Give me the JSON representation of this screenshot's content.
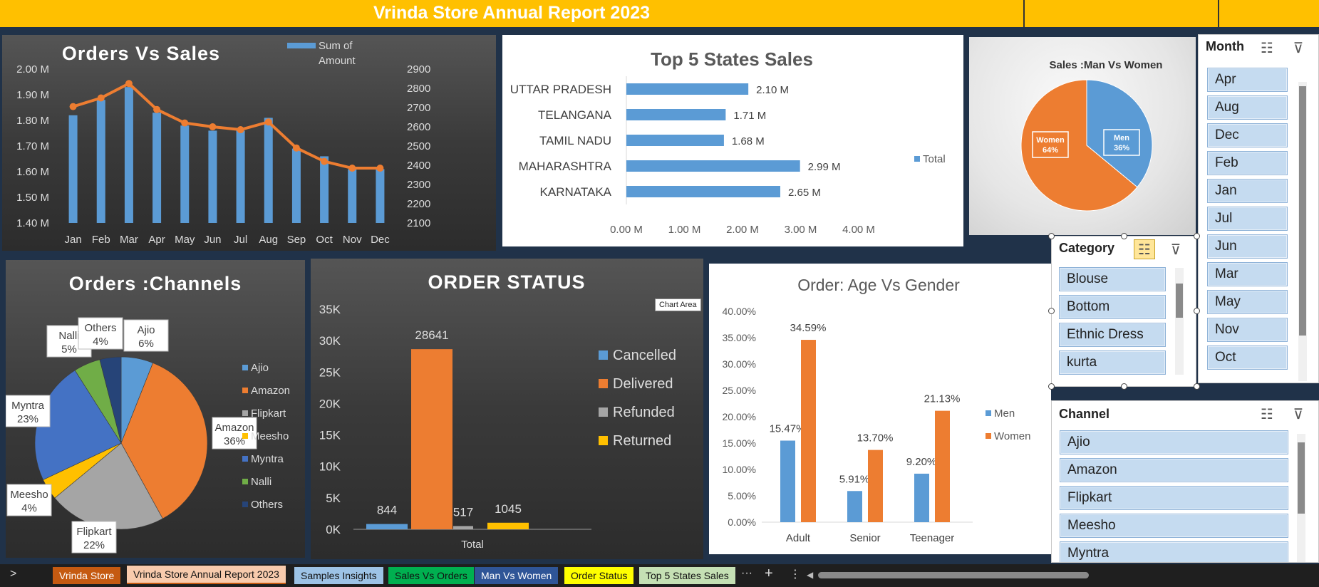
{
  "report_title": "Vrinda Store Annual Report 2023",
  "chart_area_tooltip": "Chart Area",
  "charts": {
    "orders_sales": {
      "title": "Orders Vs Sales",
      "legend_label_1": "Sum of",
      "legend_label_2": "Amount",
      "categories": [
        "Jan",
        "Feb",
        "Mar",
        "Apr",
        "May",
        "Jun",
        "Jul",
        "Aug",
        "Sep",
        "Oct",
        "Nov",
        "Dec"
      ],
      "left_ticks": [
        "2.00 M",
        "1.90 M",
        "1.80 M",
        "1.70 M",
        "1.60 M",
        "1.50 M",
        "1.40 M"
      ],
      "right_ticks": [
        "2900",
        "2800",
        "2700",
        "2600",
        "2500",
        "2400",
        "2300",
        "2200",
        "2100"
      ],
      "amount_values": [
        1.82,
        1.88,
        1.93,
        1.83,
        1.78,
        1.76,
        1.76,
        1.81,
        1.69,
        1.66,
        1.61,
        1.61
      ],
      "orders_values": [
        2705,
        2750,
        2825,
        2690,
        2620,
        2600,
        2585,
        2625,
        2490,
        2420,
        2385,
        2385
      ],
      "left_range": [
        1.4,
        2.0
      ],
      "right_range": [
        2100,
        2900
      ],
      "bar_color": "#5B9BD5",
      "line_color": "#ED7D31"
    },
    "top_states": {
      "title": "Top 5 States Sales",
      "states": [
        "UTTAR PRADESH",
        "TELANGANA",
        "TAMIL NADU",
        "MAHARASHTRA",
        "KARNATAKA"
      ],
      "values": [
        2.1,
        1.71,
        1.68,
        2.99,
        2.65
      ],
      "value_labels": [
        "2.10 M",
        "1.71 M",
        "1.68 M",
        "2.99 M",
        "2.65 M"
      ],
      "x_ticks": [
        "0.00 M",
        "1.00 M",
        "2.00 M",
        "3.00 M",
        "4.00 M"
      ],
      "x_range": [
        0,
        4
      ],
      "legend": "Total",
      "bar_color": "#5B9BD5"
    },
    "man_women": {
      "title": "Sales :Man Vs Women",
      "slices": [
        {
          "label": "Men",
          "pct_label": "36%",
          "value": 36,
          "color": "#5B9BD5"
        },
        {
          "label": "Women",
          "pct_label": "64%",
          "value": 64,
          "color": "#ED7D31"
        }
      ]
    },
    "channels": {
      "title": "Orders :Channels",
      "slices": [
        {
          "label": "Ajio",
          "pct_label": "6%",
          "value": 6,
          "color": "#5B9BD5"
        },
        {
          "label": "Amazon",
          "pct_label": "36%",
          "value": 36,
          "color": "#ED7D31"
        },
        {
          "label": "Flipkart",
          "pct_label": "22%",
          "value": 22,
          "color": "#A5A5A5"
        },
        {
          "label": "Meesho",
          "pct_label": "4%",
          "value": 4,
          "color": "#FFC000"
        },
        {
          "label": "Myntra",
          "pct_label": "23%",
          "value": 23,
          "color": "#4472C4"
        },
        {
          "label": "Nalli",
          "pct_label": "5%",
          "value": 5,
          "color": "#70AD47"
        },
        {
          "label": "Others",
          "pct_label": "4%",
          "value": 4,
          "color": "#264478"
        }
      ]
    },
    "order_status": {
      "title": "ORDER STATUS",
      "xlabel": "Total",
      "y_ticks": [
        "35K",
        "30K",
        "25K",
        "20K",
        "15K",
        "10K",
        "5K",
        "0K"
      ],
      "y_range": [
        0,
        35000
      ],
      "series": [
        {
          "name": "Cancelled",
          "value": 844,
          "label": "844",
          "color": "#5B9BD5"
        },
        {
          "name": "Delivered",
          "value": 28641,
          "label": "28641",
          "color": "#ED7D31"
        },
        {
          "name": "Refunded",
          "value": 517,
          "label": "517",
          "color": "#A5A5A5"
        },
        {
          "name": "Returned",
          "value": 1045,
          "label": "1045",
          "color": "#FFC000"
        }
      ]
    },
    "age_gender": {
      "title": "Order: Age Vs Gender",
      "categories": [
        "Adult",
        "Senior",
        "Teenager"
      ],
      "y_ticks": [
        "40.00%",
        "35.00%",
        "30.00%",
        "25.00%",
        "20.00%",
        "15.00%",
        "10.00%",
        "5.00%",
        "0.00%"
      ],
      "y_range": [
        0,
        40
      ],
      "series": [
        {
          "name": "Men",
          "values": [
            15.47,
            5.91,
            9.2
          ],
          "labels": [
            "15.47%",
            "5.91%",
            "9.20%"
          ],
          "color": "#5B9BD5"
        },
        {
          "name": "Women",
          "values": [
            34.59,
            13.7,
            21.13
          ],
          "labels": [
            "34.59%",
            "13.70%",
            "21.13%"
          ],
          "color": "#ED7D31"
        }
      ]
    }
  },
  "chart_data": [
    {
      "type": "bar",
      "title": "Orders Vs Sales",
      "categories": [
        "Jan",
        "Feb",
        "Mar",
        "Apr",
        "May",
        "Jun",
        "Jul",
        "Aug",
        "Sep",
        "Oct",
        "Nov",
        "Dec"
      ],
      "series": [
        {
          "name": "Sum of Amount",
          "values": [
            1.82,
            1.88,
            1.93,
            1.83,
            1.78,
            1.76,
            1.76,
            1.81,
            1.69,
            1.66,
            1.61,
            1.61
          ]
        },
        {
          "values": [
            2705,
            2750,
            2825,
            2690,
            2620,
            2600,
            2585,
            2625,
            2490,
            2420,
            2385,
            2385
          ]
        }
      ],
      "ylim": [
        1.4,
        2.0
      ],
      "y2lim": [
        2100,
        2900
      ]
    },
    {
      "type": "bar",
      "title": "Top 5 States Sales",
      "categories": [
        "UTTAR PRADESH",
        "TELANGANA",
        "TAMIL NADU",
        "MAHARASHTRA",
        "KARNATAKA"
      ],
      "series": [
        {
          "name": "Total",
          "values": [
            2.1,
            1.71,
            1.68,
            2.99,
            2.65
          ]
        }
      ],
      "xlim": [
        0,
        4
      ]
    },
    {
      "type": "pie",
      "title": "Sales :Man Vs Women",
      "categories": [
        "Men",
        "Women"
      ],
      "values": [
        36,
        64
      ]
    },
    {
      "type": "pie",
      "title": "Orders :Channels",
      "categories": [
        "Ajio",
        "Amazon",
        "Flipkart",
        "Meesho",
        "Myntra",
        "Nalli",
        "Others"
      ],
      "values": [
        6,
        36,
        22,
        4,
        23,
        5,
        4
      ]
    },
    {
      "type": "bar",
      "title": "ORDER STATUS",
      "categories": [
        "Total"
      ],
      "series": [
        {
          "name": "Cancelled",
          "values": [
            844
          ]
        },
        {
          "name": "Delivered",
          "values": [
            28641
          ]
        },
        {
          "name": "Refunded",
          "values": [
            517
          ]
        },
        {
          "name": "Returned",
          "values": [
            1045
          ]
        }
      ],
      "ylim": [
        0,
        35000
      ]
    },
    {
      "type": "bar",
      "title": "Order: Age Vs Gender",
      "categories": [
        "Adult",
        "Senior",
        "Teenager"
      ],
      "series": [
        {
          "name": "Men",
          "values": [
            15.47,
            5.91,
            9.2
          ]
        },
        {
          "name": "Women",
          "values": [
            34.59,
            13.7,
            21.13
          ]
        }
      ],
      "ylim": [
        0,
        40
      ]
    }
  ],
  "slicers": {
    "month": {
      "header": "Month",
      "items": [
        "Apr",
        "Aug",
        "Dec",
        "Feb",
        "Jan",
        "Jul",
        "Jun",
        "Mar",
        "May",
        "Nov",
        "Oct"
      ]
    },
    "category": {
      "header": "Category",
      "items": [
        "Blouse",
        "Bottom",
        "Ethnic Dress",
        "kurta"
      ]
    },
    "channel": {
      "header": "Channel",
      "items": [
        "Ajio",
        "Amazon",
        "Flipkart",
        "Meesho",
        "Myntra"
      ]
    }
  },
  "tabs": [
    {
      "label": "Vrinda Store",
      "color": "#C55A11",
      "text_color": "#ffffff"
    },
    {
      "label": "Vrinda Store Annual Report 2023",
      "color": "#F8CBAD",
      "text_color": "#111111"
    },
    {
      "label": "Samples Insights",
      "color": "#9DC3E6",
      "text_color": "#111111"
    },
    {
      "label": "Sales Vs Orders",
      "color": "#00B050",
      "text_color": "#111111"
    },
    {
      "label": "Man Vs Women",
      "color": "#2F5597",
      "text_color": "#ffffff"
    },
    {
      "label": "Order Status",
      "color": "#FFFF00",
      "text_color": "#111111"
    },
    {
      "label": "Top 5 States Sales",
      "color": "#C5E0B4",
      "text_color": "#111111"
    }
  ],
  "tab_controls": {
    "prev": ">",
    "more": "···",
    "add": "+",
    "menu": "⋮"
  }
}
